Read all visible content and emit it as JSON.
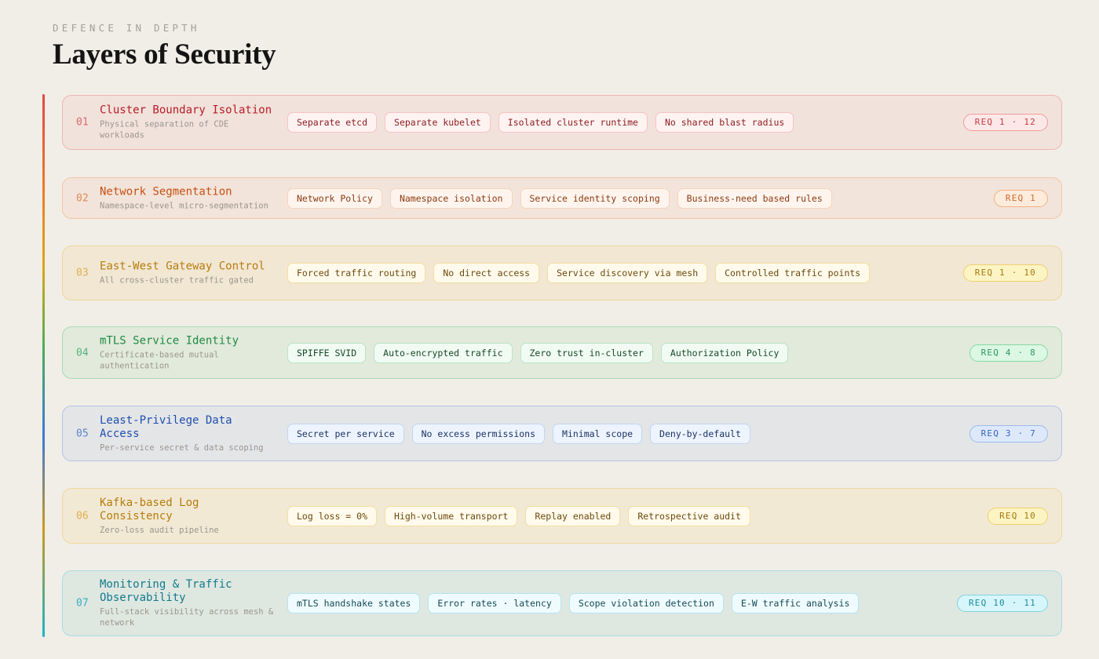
{
  "header": {
    "eyebrow": "DEFENCE IN DEPTH",
    "title": "Layers of Security"
  },
  "layers": [
    {
      "num": "01",
      "name": "Cluster Boundary Isolation",
      "desc": "Physical separation of CDE workloads",
      "chips": [
        "Separate etcd",
        "Separate kubelet",
        "Isolated cluster runtime",
        "No shared blast radius"
      ],
      "req": "REQ 1 · 12",
      "colors": {
        "bg": "#f2e2dc",
        "border": "#f0b5b2",
        "num": "#d96a6a",
        "name": "#b81c24",
        "chip_bg": "#fff3f2",
        "chip_border": "#f6c3c3",
        "chip_text": "#8c1e22",
        "req_bg": "#fde8e8",
        "req_border": "#f09b9b",
        "req_text": "#c8393e"
      }
    },
    {
      "num": "02",
      "name": "Network Segmentation",
      "desc": "Namespace-level micro-segmentation",
      "chips": [
        "Network Policy",
        "Namespace isolation",
        "Service identity scoping",
        "Business-need based rules"
      ],
      "req": "REQ 1",
      "colors": {
        "bg": "#f2e4da",
        "border": "#f2c6a6",
        "num": "#dd8a55",
        "name": "#c74f12",
        "chip_bg": "#fff5ee",
        "chip_border": "#f6d3bb",
        "chip_text": "#8a3a12",
        "req_bg": "#fdebdc",
        "req_border": "#f2b182",
        "req_text": "#d0682e"
      }
    },
    {
      "num": "03",
      "name": "East-West Gateway Control",
      "desc": "All cross-cluster traffic gated",
      "chips": [
        "Forced traffic routing",
        "No direct access",
        "Service discovery via mesh",
        "Controlled traffic points"
      ],
      "req": "REQ 1 · 10",
      "colors": {
        "bg": "#f1e7d3",
        "border": "#f0d49c",
        "num": "#e0b052",
        "name": "#b77c0c",
        "chip_bg": "#fffaec",
        "chip_border": "#f4df9f",
        "chip_text": "#6c4a0c",
        "req_bg": "#fdf4c4",
        "req_border": "#eed16a",
        "req_text": "#a8780e"
      }
    },
    {
      "num": "04",
      "name": "mTLS Service Identity",
      "desc": "Certificate-based mutual authentication",
      "chips": [
        "SPIFFE SVID",
        "Auto-encrypted traffic",
        "Zero trust in-cluster",
        "Authorization Policy"
      ],
      "req": "REQ 4 · 8",
      "colors": {
        "bg": "#e2eadb",
        "border": "#a9dcb5",
        "num": "#55b47a",
        "name": "#1e8a44",
        "chip_bg": "#f1fbf3",
        "chip_border": "#b7e6c4",
        "chip_text": "#17492b",
        "req_bg": "#dcf7e4",
        "req_border": "#86d9a2",
        "req_text": "#2d9b5c"
      }
    },
    {
      "num": "05",
      "name": "Least-Privilege Data Access",
      "desc": "Per-service secret & data scoping",
      "chips": [
        "Secret per service",
        "No excess permissions",
        "Minimal scope",
        "Deny-by-default"
      ],
      "req": "REQ 3 · 7",
      "colors": {
        "bg": "#e4e5e7",
        "border": "#b3c6e6",
        "num": "#5b86cc",
        "name": "#1d4fae",
        "chip_bg": "#eef4fd",
        "chip_border": "#c2d5f2",
        "chip_text": "#1a3268",
        "req_bg": "#dde9fb",
        "req_border": "#9ebbea",
        "req_text": "#3665c2"
      }
    },
    {
      "num": "06",
      "name": "Kafka-based Log Consistency",
      "desc": "Zero-loss audit pipeline",
      "chips": [
        "Log loss = 0%",
        "High-volume transport",
        "Replay enabled",
        "Retrospective audit"
      ],
      "req": "REQ 10",
      "colors": {
        "bg": "#f1e9d4",
        "border": "#f0d8a0",
        "num": "#e0b052",
        "name": "#b77c0c",
        "chip_bg": "#fffaec",
        "chip_border": "#f4df9f",
        "chip_text": "#6c4a0c",
        "req_bg": "#fdf4c4",
        "req_border": "#eed16a",
        "req_text": "#a8780e"
      }
    },
    {
      "num": "07",
      "name": "Monitoring & Traffic Observability",
      "desc": "Full-stack visibility across mesh & network",
      "chips": [
        "mTLS handshake states",
        "Error rates · latency",
        "Scope violation detection",
        "E-W traffic analysis"
      ],
      "req": "REQ 10 · 11",
      "colors": {
        "bg": "#dfe7e1",
        "border": "#a8dce4",
        "num": "#3aaec0",
        "name": "#117a8c",
        "chip_bg": "#f0fbfd",
        "chip_border": "#b4e6ee",
        "chip_text": "#124a56",
        "req_bg": "#d7f6fb",
        "req_border": "#80d3e0",
        "req_text": "#1b8b9d"
      }
    }
  ]
}
